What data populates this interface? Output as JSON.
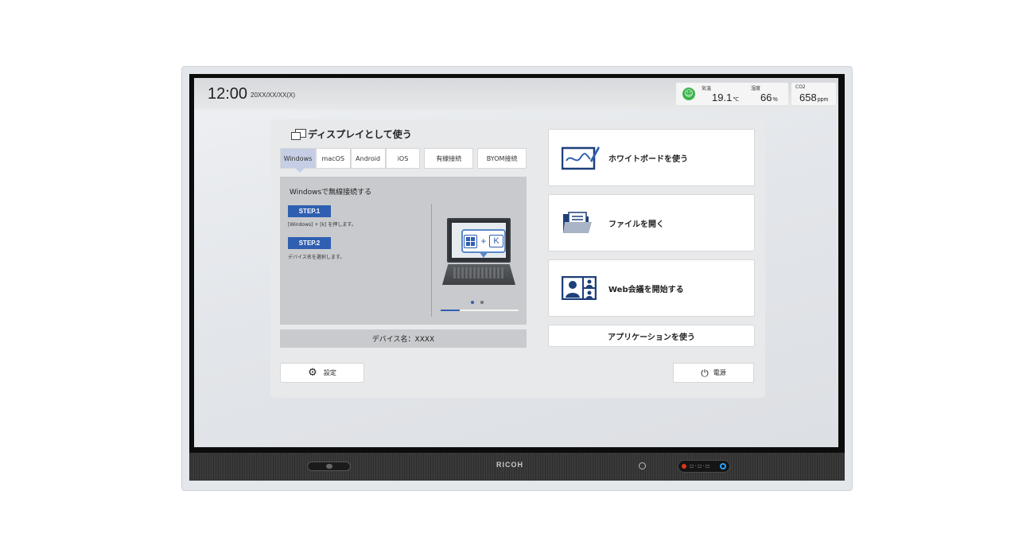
{
  "status_bar": {
    "time": "12:00",
    "date": "20XX/XX/XX(X)",
    "temperature": {
      "label": "気温",
      "value": "19.1",
      "unit": "℃"
    },
    "humidity": {
      "label": "湿度",
      "value": "66",
      "unit": "%"
    },
    "co2": {
      "label": "CO2",
      "value": "658",
      "unit": "ppm"
    },
    "comfort_icon": "smiley-face-icon",
    "comfort_color": "#3bb44a"
  },
  "display_section": {
    "heading": "ディスプレイとして使う",
    "tabs": [
      {
        "label": "Windows",
        "active": true
      },
      {
        "label": "macOS",
        "active": false
      },
      {
        "label": "Android",
        "active": false
      },
      {
        "label": "iOS",
        "active": false
      },
      {
        "label": "有線接続",
        "active": false
      },
      {
        "label": "BYOM接続",
        "active": false
      }
    ],
    "guide": {
      "title": "Windowsで無線接続する",
      "steps": [
        {
          "badge": "STEP.1",
          "description": "[Windows] + [k] を押します。"
        },
        {
          "badge": "STEP.2",
          "description": "デバイス名を選択します。"
        }
      ],
      "illustration_keys": {
        "plus": "+",
        "key": "K"
      },
      "page_dots": 2,
      "current_page": 1
    },
    "device_name": "デバイス名：XXXX"
  },
  "actions": {
    "whiteboard": "ホワイトボードを使う",
    "open_file": "ファイルを開く",
    "web_meeting": "Web会議を開始する",
    "applications": "アプリケーションを使う"
  },
  "footer_buttons": {
    "settings": "設定",
    "power": "電源"
  },
  "hardware": {
    "brand": "RICOH",
    "accent_color": "#2f5fb1"
  }
}
